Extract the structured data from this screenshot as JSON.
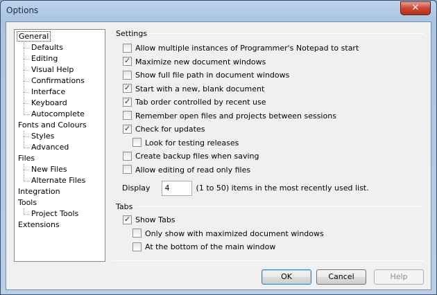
{
  "window": {
    "title": "Options",
    "close_glyph": "✕"
  },
  "tree": [
    {
      "label": "General",
      "level": 0,
      "selected": true
    },
    {
      "label": "Defaults",
      "level": 1
    },
    {
      "label": "Editing",
      "level": 1
    },
    {
      "label": "Visual Help",
      "level": 1
    },
    {
      "label": "Confirmations",
      "level": 1
    },
    {
      "label": "Interface",
      "level": 1
    },
    {
      "label": "Keyboard",
      "level": 1
    },
    {
      "label": "Autocomplete",
      "level": 1
    },
    {
      "label": "Fonts and Colours",
      "level": 0
    },
    {
      "label": "Styles",
      "level": 1
    },
    {
      "label": "Advanced",
      "level": 1
    },
    {
      "label": "Files",
      "level": 0
    },
    {
      "label": "New Files",
      "level": 1
    },
    {
      "label": "Alternate Files",
      "level": 1
    },
    {
      "label": "Integration",
      "level": 0
    },
    {
      "label": "Tools",
      "level": 0
    },
    {
      "label": "Project Tools",
      "level": 1
    },
    {
      "label": "Extensions",
      "level": 0
    }
  ],
  "settings": {
    "title": "Settings",
    "options": [
      {
        "label": "Allow multiple instances of Programmer's Notepad to start",
        "checked": false,
        "indent": 0
      },
      {
        "label": "Maximize new document windows",
        "checked": true,
        "indent": 0
      },
      {
        "label": "Show full file path in document windows",
        "checked": false,
        "indent": 0
      },
      {
        "label": "Start with a new, blank document",
        "checked": true,
        "indent": 0
      },
      {
        "label": "Tab order controlled by recent use",
        "checked": true,
        "indent": 0
      },
      {
        "label": "Remember open files and projects between sessions",
        "checked": false,
        "indent": 0
      },
      {
        "label": "Check for updates",
        "checked": true,
        "indent": 0
      },
      {
        "label": "Look for testing releases",
        "checked": false,
        "indent": 1
      },
      {
        "label": "Create backup files when saving",
        "checked": false,
        "indent": 0
      },
      {
        "label": "Allow editing of read only files",
        "checked": false,
        "indent": 0
      }
    ],
    "mru": {
      "label": "Display",
      "value": "4",
      "suffix": "(1 to 50) items in the most recently used list."
    }
  },
  "tabs": {
    "title": "Tabs",
    "options": [
      {
        "label": "Show Tabs",
        "checked": true,
        "indent": 0
      },
      {
        "label": "Only show with maximized document windows",
        "checked": false,
        "indent": 1
      },
      {
        "label": "At the bottom of the main window",
        "checked": false,
        "indent": 1
      }
    ]
  },
  "buttons": {
    "ok": "OK",
    "cancel": "Cancel",
    "help": "Help"
  }
}
